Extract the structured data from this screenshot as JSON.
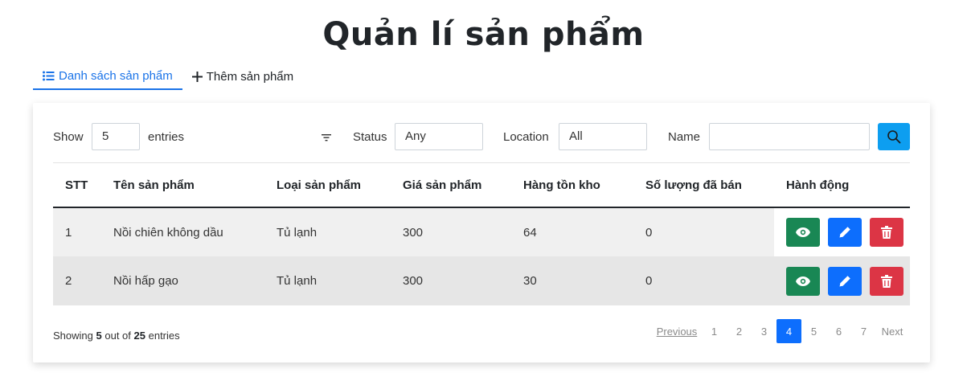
{
  "page": {
    "title": "Quản lí sản phẩm"
  },
  "tabs": [
    {
      "label": "Danh sách sản phẩm",
      "icon": "list-icon",
      "active": true
    },
    {
      "label": "Thêm sản phẩm",
      "icon": "plus-icon",
      "active": false
    }
  ],
  "filters": {
    "show_label": "Show",
    "show_value": "5",
    "entries_label": "entries",
    "filter_icon": "filter-icon",
    "status_label": "Status",
    "status_value": "Any",
    "location_label": "Location",
    "location_value": "All",
    "name_label": "Name",
    "name_value": "",
    "search_icon": "search-icon"
  },
  "table": {
    "headers": [
      "STT",
      "Tên sản phẩm",
      "Loại sản phẩm",
      "Giá sản phẩm",
      "Hàng tồn kho",
      "Số lượng đã bán",
      "Hành động"
    ],
    "rows": [
      {
        "stt": "1",
        "name": "Nồi chiên không dầu",
        "type": "Tủ lạnh",
        "price": "300",
        "stock": "64",
        "sold": "0"
      },
      {
        "stt": "2",
        "name": "Nồi hấp gạo",
        "type": "Tủ lạnh",
        "price": "300",
        "stock": "30",
        "sold": "0"
      }
    ],
    "action_icons": [
      "eye-icon",
      "pencil-icon",
      "trash-icon"
    ]
  },
  "footer": {
    "showing_prefix": "Showing",
    "showing_count": "5",
    "showing_mid": "out of",
    "showing_total": "25",
    "showing_suffix": "entries"
  },
  "pagination": {
    "previous": "Previous",
    "pages": [
      "1",
      "2",
      "3",
      "4",
      "5",
      "6",
      "7"
    ],
    "current": "4",
    "next": "Next"
  },
  "colors": {
    "accent": "#1a73e8",
    "search_button": "#0d9ef0",
    "view": "#198754",
    "edit": "#0d6efd",
    "delete": "#dc3545"
  }
}
